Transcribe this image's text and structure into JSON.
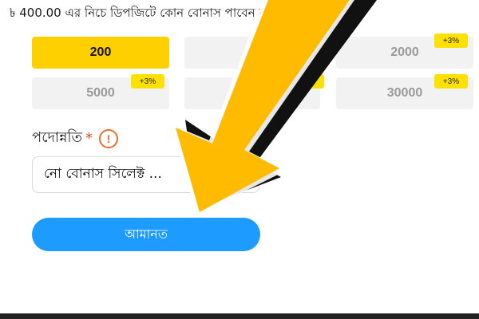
{
  "deposit": {
    "notice": "৳ 400.00 এর নিচে ডিপজিটে কোন বোনাস পাবেন না",
    "amounts": [
      {
        "label": "200",
        "selected": true,
        "badge": ""
      },
      {
        "label": "",
        "selected": false,
        "badge": ""
      },
      {
        "label": "2000",
        "selected": false,
        "badge": "+3%"
      },
      {
        "label": "5000",
        "selected": false,
        "badge": "+3%"
      },
      {
        "label": "",
        "selected": false,
        "badge": "+3%"
      },
      {
        "label": "30000",
        "selected": false,
        "badge": "+3%"
      }
    ],
    "promotion": {
      "label": "পদোন্নতি",
      "required_mark": "*",
      "info_icon": "!",
      "select_value": "নো বোনাস সিলেক্ট ..."
    },
    "submit_label": "আমানত"
  },
  "colors": {
    "selected": "#ffd000",
    "badge": "#ffe100",
    "button": "#1e9bff",
    "arrow": "#ffbb00"
  },
  "icons": {
    "overlay": "arrow-icon",
    "info": "warning-icon"
  }
}
